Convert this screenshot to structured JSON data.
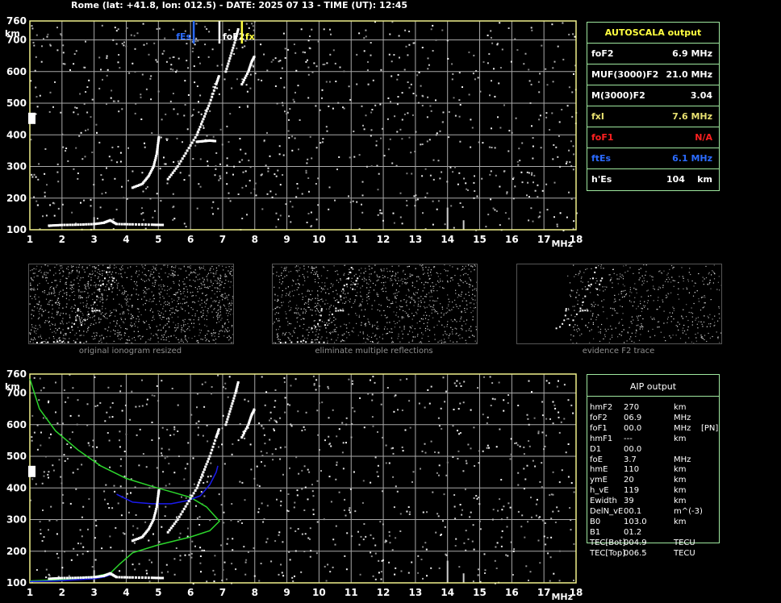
{
  "header": {
    "title": "Rome (lat: +41.8, lon: 012.5) - DATE: 2025 07 13 - TIME (UT): 12:45"
  },
  "colors": {
    "grid": "#a8a8a8",
    "frame": "#f0f08a",
    "panel_border": "#9fe89f",
    "es_marker": "#2b6bff",
    "fx_marker": "#ffff40",
    "profile": "#2cd62c",
    "trace_fit": "#1a1aee"
  },
  "chart_data": [
    {
      "type": "scatter",
      "title": "",
      "xlabel": "MHz",
      "ylabel": "km",
      "xlim": [
        1,
        18
      ],
      "ylim": [
        100,
        760
      ],
      "x_ticks": [
        "1",
        "2",
        "3",
        "4",
        "5",
        "6",
        "7",
        "8",
        "9",
        "10",
        "11",
        "12",
        "13",
        "14",
        "15",
        "16",
        "17",
        "18"
      ],
      "y_ticks": [
        "100",
        "200",
        "300",
        "400",
        "500",
        "600",
        "700",
        "760"
      ],
      "grid": true,
      "markers": [
        {
          "label": "fEs",
          "x": 6.1,
          "color": "#2b6bff"
        },
        {
          "label": "foF2",
          "x": 6.9,
          "color": "#ffffff"
        },
        {
          "label": "fx",
          "x": 7.6,
          "color": "#ffff40"
        }
      ],
      "series": [
        {
          "values": [
            [
              1.6,
              113
            ],
            [
              2,
              115
            ],
            [
              2.5,
              116
            ],
            [
              3,
              118
            ],
            [
              3.3,
              122
            ],
            [
              3.5,
              130
            ],
            [
              3.7,
              118
            ],
            [
              4.2,
              117
            ],
            [
              4.8,
              116
            ],
            [
              5.2,
              115
            ]
          ]
        },
        {
          "values": [
            [
              4.2,
              233
            ],
            [
              4.5,
              245
            ],
            [
              4.7,
              270
            ],
            [
              4.85,
              300
            ],
            [
              4.95,
              340
            ],
            [
              5.0,
              380
            ],
            [
              5.02,
              395
            ]
          ]
        },
        {
          "values": [
            [
              5.3,
              260
            ],
            [
              5.6,
              300
            ],
            [
              5.9,
              350
            ],
            [
              6.2,
              400
            ],
            [
              6.4,
              450
            ],
            [
              6.6,
              500
            ],
            [
              6.8,
              560
            ],
            [
              6.9,
              590
            ]
          ]
        },
        {
          "values": [
            [
              6.2,
              378
            ],
            [
              6.4,
              380
            ],
            [
              6.6,
              382
            ],
            [
              6.8,
              380
            ]
          ]
        },
        {
          "values": [
            [
              7.1,
              600
            ],
            [
              7.25,
              650
            ],
            [
              7.4,
              700
            ],
            [
              7.5,
              740
            ]
          ]
        },
        {
          "values": [
            [
              7.6,
              560
            ],
            [
              7.8,
              600
            ],
            [
              7.9,
              630
            ],
            [
              8.0,
              650
            ]
          ]
        }
      ]
    },
    {
      "type": "scatter",
      "title": "",
      "xlabel": "MHz",
      "ylabel": "km",
      "xlim": [
        1,
        18
      ],
      "ylim": [
        100,
        760
      ],
      "x_ticks": [
        "1",
        "2",
        "3",
        "4",
        "5",
        "6",
        "7",
        "8",
        "9",
        "10",
        "11",
        "12",
        "13",
        "14",
        "15",
        "16",
        "17",
        "18"
      ],
      "y_ticks": [
        "100",
        "200",
        "300",
        "400",
        "500",
        "600",
        "700",
        "760"
      ],
      "grid": true,
      "series": [
        {
          "values": [
            [
              1.0,
              745
            ],
            [
              1.3,
              650
            ],
            [
              1.8,
              580
            ],
            [
              2.5,
              520
            ],
            [
              3.2,
              470
            ],
            [
              4.0,
              430
            ],
            [
              4.8,
              405
            ],
            [
              5.5,
              385
            ],
            [
              6.0,
              370
            ],
            [
              6.5,
              340
            ],
            [
              6.9,
              295
            ],
            [
              6.6,
              265
            ],
            [
              6.0,
              245
            ],
            [
              5.0,
              220
            ],
            [
              4.2,
              195
            ],
            [
              3.8,
              160
            ],
            [
              3.5,
              130
            ],
            [
              3.0,
              120
            ],
            [
              2.0,
              110
            ],
            [
              1.0,
              106
            ]
          ]
        },
        {
          "values": [
            [
              3.7,
              380
            ],
            [
              4.2,
              355
            ],
            [
              4.8,
              350
            ],
            [
              5.4,
              350
            ],
            [
              5.9,
              360
            ],
            [
              6.3,
              375
            ],
            [
              6.6,
              410
            ],
            [
              6.8,
              450
            ],
            [
              6.85,
              470
            ]
          ]
        },
        {
          "values": [
            [
              1.0,
              104
            ],
            [
              1.8,
              106
            ],
            [
              2.5,
              110
            ],
            [
              3.0,
              113
            ],
            [
              3.3,
              118
            ],
            [
              3.5,
              125
            ]
          ]
        },
        {
          "values": [
            [
              1.6,
              113
            ],
            [
              2,
              115
            ],
            [
              2.5,
              116
            ],
            [
              3,
              118
            ],
            [
              3.3,
              122
            ],
            [
              3.5,
              130
            ],
            [
              3.7,
              118
            ],
            [
              4.2,
              117
            ],
            [
              4.8,
              116
            ],
            [
              5.2,
              115
            ]
          ]
        },
        {
          "values": [
            [
              4.2,
              233
            ],
            [
              4.5,
              245
            ],
            [
              4.7,
              270
            ],
            [
              4.85,
              300
            ],
            [
              4.95,
              340
            ],
            [
              5.0,
              380
            ],
            [
              5.02,
              395
            ]
          ]
        },
        {
          "values": [
            [
              5.3,
              260
            ],
            [
              5.6,
              300
            ],
            [
              5.9,
              350
            ],
            [
              6.2,
              400
            ],
            [
              6.4,
              450
            ],
            [
              6.6,
              500
            ],
            [
              6.8,
              560
            ],
            [
              6.9,
              590
            ]
          ]
        },
        {
          "values": [
            [
              7.1,
              600
            ],
            [
              7.25,
              650
            ],
            [
              7.4,
              700
            ],
            [
              7.5,
              740
            ]
          ]
        },
        {
          "values": [
            [
              7.6,
              560
            ],
            [
              7.8,
              600
            ],
            [
              7.9,
              630
            ],
            [
              8.0,
              650
            ]
          ]
        }
      ]
    }
  ],
  "thumbnails": [
    {
      "caption": "original ionogram resized"
    },
    {
      "caption": "eliminate multiple reflections"
    },
    {
      "caption": "evidence F2 trace"
    }
  ],
  "autoscala": {
    "title": "AUTOSCALA output",
    "rows": [
      {
        "label": "foF2",
        "value": "6.9 MHz",
        "color": "#ffffff"
      },
      {
        "label": "MUF(3000)F2",
        "value": "21.0 MHz",
        "color": "#ffffff"
      },
      {
        "label": "M(3000)F2",
        "value": "3.04",
        "color": "#ffffff"
      },
      {
        "label": "fxI",
        "value": "7.6 MHz",
        "color": "#e8e070"
      },
      {
        "label": "foF1",
        "value": "N/A",
        "color": "#ff2020"
      },
      {
        "label": "ftEs",
        "value": "6.1 MHz",
        "color": "#2b6bff"
      },
      {
        "label": "h'Es",
        "value": "104    km",
        "color": "#ffffff"
      }
    ]
  },
  "aip": {
    "title": "AIP output",
    "rows": [
      {
        "name": "hmF2",
        "value": "270",
        "unit": "km",
        "extra": ""
      },
      {
        "name": "foF2",
        "value": "06.9",
        "unit": "MHz",
        "extra": ""
      },
      {
        "name": "foF1",
        "value": "00.0",
        "unit": "MHz",
        "extra": "[PN]"
      },
      {
        "name": "hmF1",
        "value": "---",
        "unit": "km",
        "extra": ""
      },
      {
        "name": "D1",
        "value": "00.0",
        "unit": "",
        "extra": ""
      },
      {
        "name": "foE",
        "value": "3.7",
        "unit": "MHz",
        "extra": ""
      },
      {
        "name": "hmE",
        "value": "110",
        "unit": "km",
        "extra": ""
      },
      {
        "name": "ymE",
        "value": "20",
        "unit": "km",
        "extra": ""
      },
      {
        "name": "h_vE",
        "value": "119",
        "unit": "km",
        "extra": ""
      },
      {
        "name": "Ewidth",
        "value": "39",
        "unit": "km",
        "extra": ""
      },
      {
        "name": "DelN_vE",
        "value": "00.1",
        "unit": "m^(-3)",
        "extra": ""
      },
      {
        "name": "B0",
        "value": "103.0",
        "unit": "km",
        "extra": ""
      },
      {
        "name": "B1",
        "value": "01.2",
        "unit": "",
        "extra": ""
      },
      {
        "name": "TEC[Bot]",
        "value": "004.9",
        "unit": "TECU",
        "extra": ""
      },
      {
        "name": "TEC[Top]",
        "value": "006.5",
        "unit": "TECU",
        "extra": ""
      }
    ]
  }
}
